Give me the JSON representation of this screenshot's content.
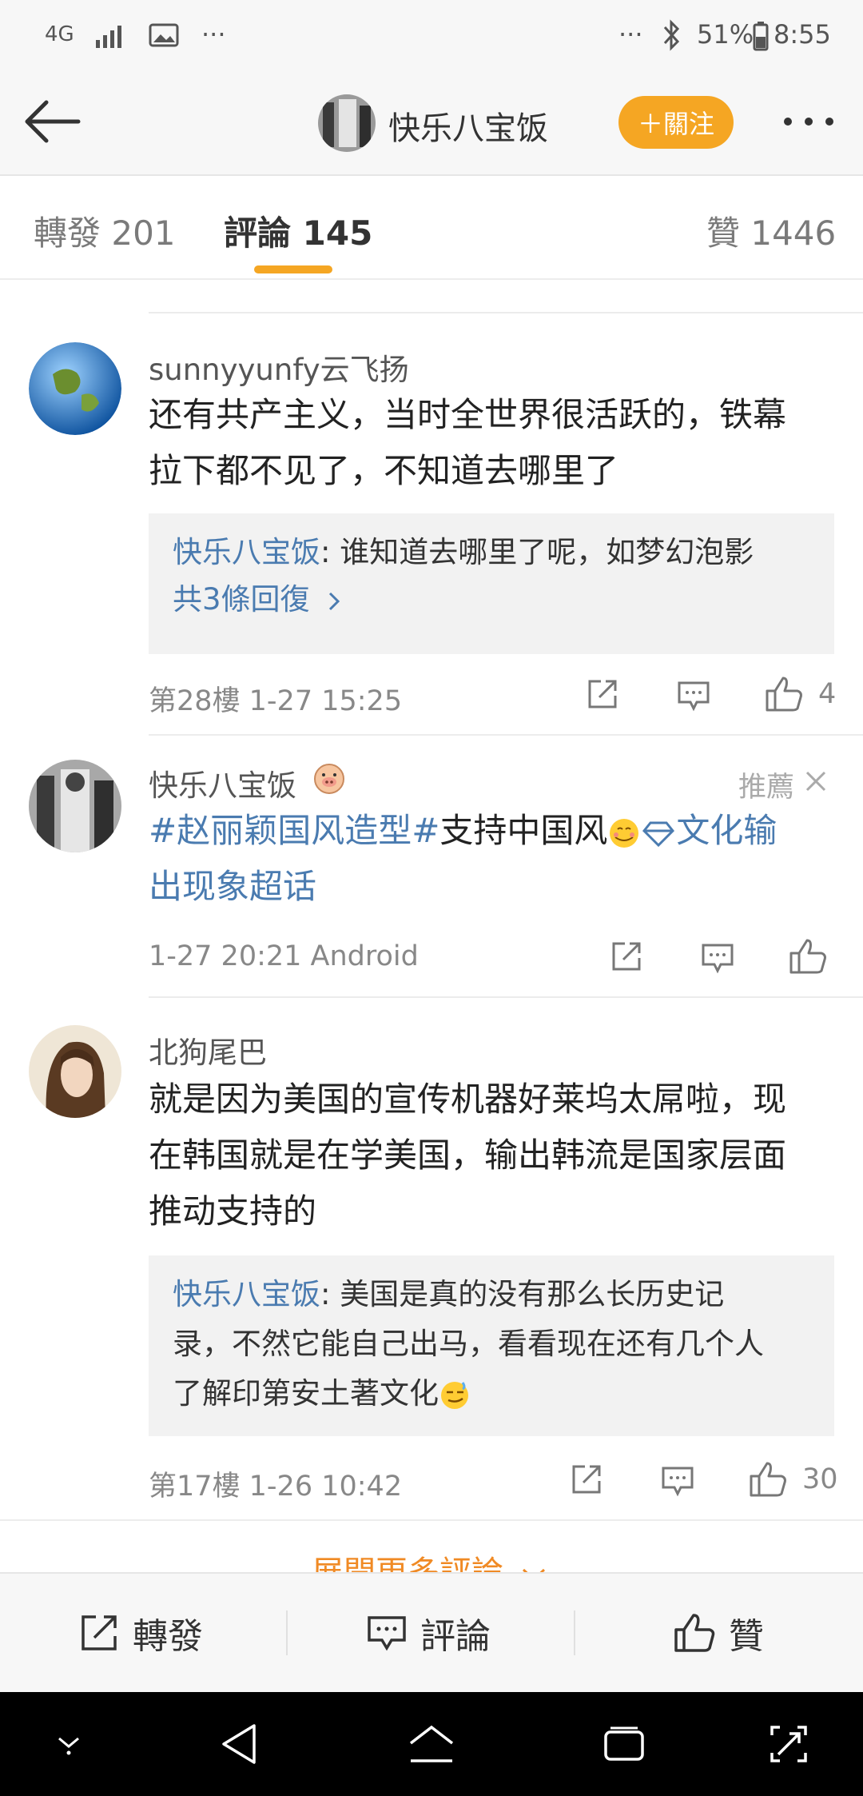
{
  "status_bar": {
    "network": "4G",
    "battery": "51%",
    "time": "8:55",
    "more_left": "···",
    "more_right": "···"
  },
  "header": {
    "title": "快乐八宝饭",
    "follow_label": "＋關注"
  },
  "tabs": {
    "repost": "轉發 201",
    "comments": "評論 145",
    "likes": "贊 1446"
  },
  "comments": [
    {
      "username": "sunnyyunfy云飞扬",
      "lines": [
        "还有共产主义，当时全世界很活跃的，铁幕",
        "拉下都不见了，不知道去哪里了"
      ],
      "reply": {
        "user": "快乐八宝饭",
        "text": ": 谁知道去哪里了呢，如梦幻泡影",
        "more": "共3條回復"
      },
      "meta": "第28樓  1-27 15:25",
      "likes": "4"
    },
    {
      "username": "快乐八宝饭",
      "recommend": "推薦",
      "topic1": "#赵丽颖国风造型#",
      "text1": "支持中国风",
      "supertopic": "文化输",
      "line2": "出现象超话",
      "meta": "1-27 20:21  Android"
    },
    {
      "username": "北狗尾巴",
      "lines": [
        "就是因为美国的宣传机器好莱坞太屌啦，现",
        "在韩国就是在学美国，输出韩流是国家层面",
        "推动支持的"
      ],
      "reply": {
        "user": "快乐八宝饭",
        "line1": ": 美国是真的没有那么长历史记",
        "line2": "录，不然它能自己出马，看看现在还有几个人",
        "line3": "了解印第安土著文化"
      },
      "meta": "第17樓  1-26 10:42",
      "likes": "30"
    }
  ],
  "expand_more": "展開更多評論",
  "bottom_bar": {
    "repost": "轉發",
    "comment": "評論",
    "like": "贊"
  },
  "colors": {
    "accent_orange": "#f5a623",
    "link_blue": "#4a7bb0"
  }
}
